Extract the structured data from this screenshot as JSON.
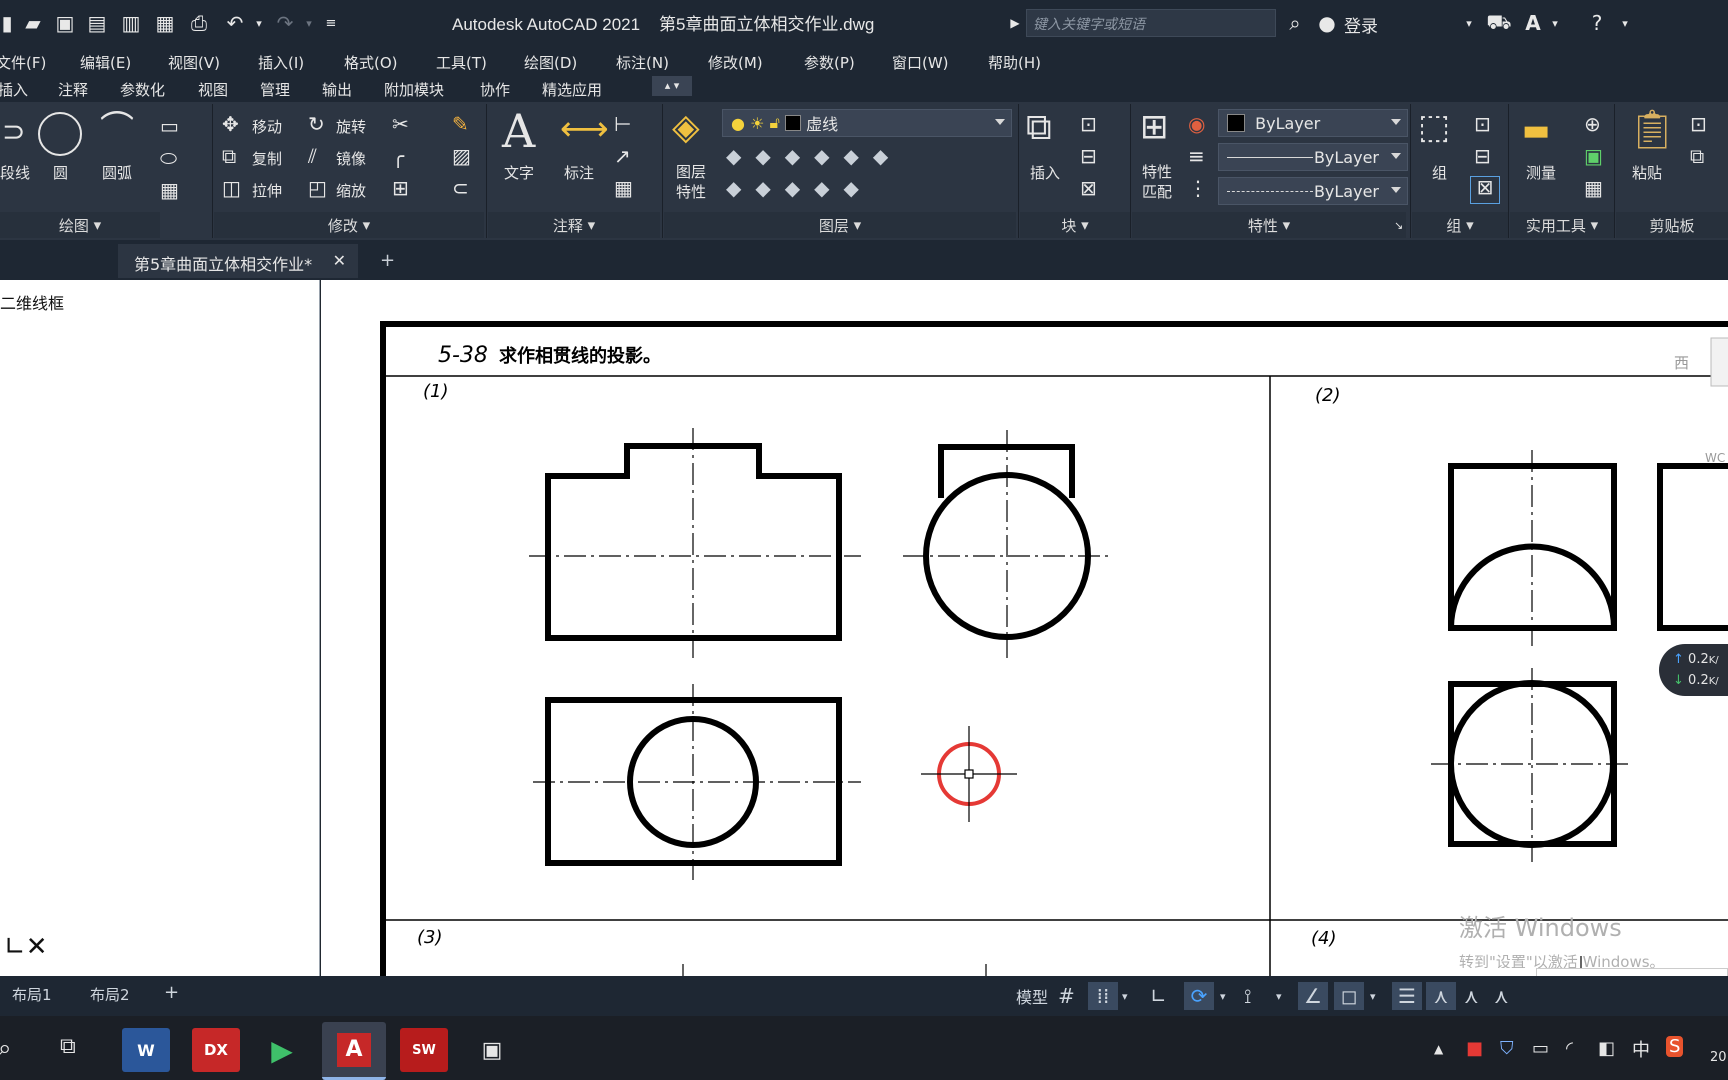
{
  "titlebar": {
    "app_name": "Autodesk AutoCAD 2021",
    "file_name": "第5章曲面立体相交作业.dwg",
    "search_placeholder": "键入关键字或短语",
    "login_label": "登录"
  },
  "menu": [
    "文件(F)",
    "编辑(E)",
    "视图(V)",
    "插入(I)",
    "格式(O)",
    "工具(T)",
    "绘图(D)",
    "标注(N)",
    "修改(M)",
    "参数(P)",
    "窗口(W)",
    "帮助(H)"
  ],
  "ribbon_tabs": [
    "插入",
    "注释",
    "参数化",
    "视图",
    "管理",
    "输出",
    "附加模块",
    "协作",
    "精选应用"
  ],
  "ribbon": {
    "draw": {
      "footer": "绘图",
      "polyline": "段线",
      "circle": "圆",
      "arc": "圆弧"
    },
    "modify": {
      "footer": "修改",
      "move": "移动",
      "rotate": "旋转",
      "copy": "复制",
      "mirror": "镜像",
      "stretch": "拉伸",
      "scale": "缩放"
    },
    "annotation": {
      "footer": "注释",
      "text": "文字",
      "dimension": "标注"
    },
    "layers": {
      "footer": "图层",
      "layer_props": "图层\n特性",
      "current_layer": "虚线"
    },
    "block": {
      "footer": "块",
      "insert": "插入"
    },
    "properties": {
      "footer": "特性",
      "match": "特性\n匹配",
      "color": "ByLayer",
      "lineweight": "ByLayer",
      "linetype": "ByLayer"
    },
    "groups": {
      "footer": "组",
      "group": "组"
    },
    "utilities": {
      "footer": "实用工具",
      "measure": "测量"
    },
    "clipboard": {
      "footer": "剪贴板",
      "paste": "粘贴"
    }
  },
  "doc_tab": {
    "label": "第5章曲面立体相交作业*",
    "close": "✕",
    "new": "+"
  },
  "left_panel": {
    "viewport_label": "二维线框"
  },
  "drawing": {
    "heading_num": "5-38",
    "heading_text": "求作相贯线的投影。",
    "q1": "(1)",
    "q2": "(2)",
    "q3": "(3)",
    "q4": "(4)",
    "corner_mark": "西",
    "side_text": "WC",
    "watermark_line1": "激活 Windows",
    "watermark_line2": "转到\"设置\"以激活 Windows。",
    "net_up": "0.2",
    "net_down": "0.2"
  },
  "layout_tabs": [
    "布局1",
    "布局2"
  ],
  "status": {
    "model_label": "模型"
  },
  "taskbar": {
    "word": "W",
    "dx": "DX",
    "autocad": "A",
    "solidworks": "SW",
    "ime": "中",
    "clock_partial": "20"
  },
  "colors": {
    "dark_bg": "#1e2733",
    "ribbon_bg": "#2c3542",
    "accent_red": "#e53935",
    "autocad_red": "#c62828"
  }
}
